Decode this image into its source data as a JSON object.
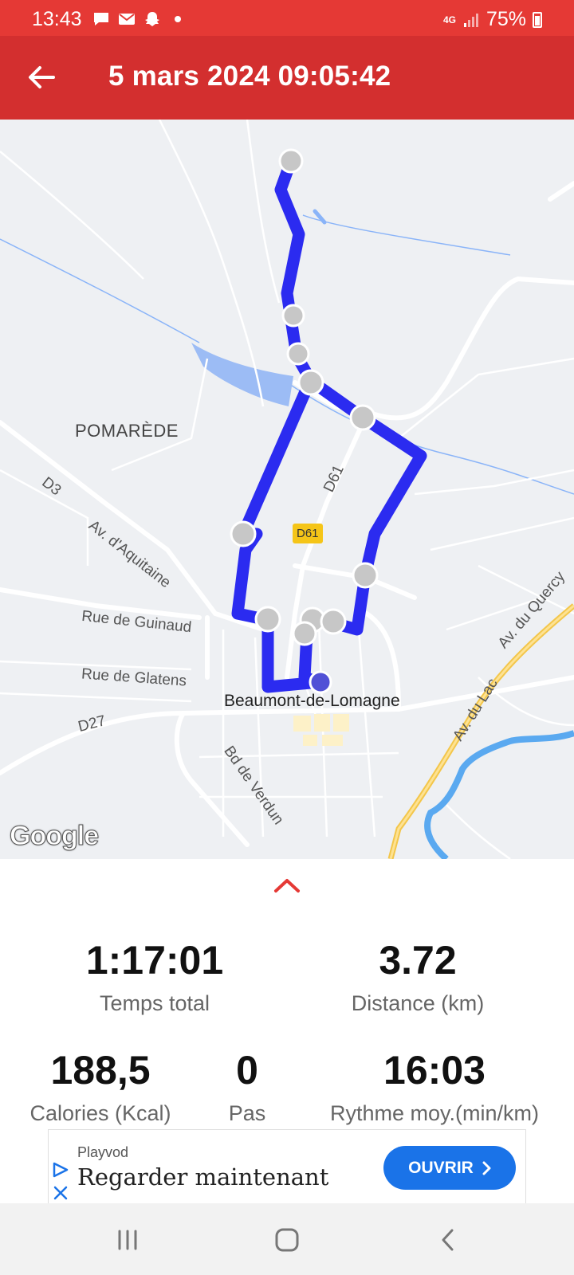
{
  "status_bar": {
    "time": "13:43",
    "network": "4G",
    "battery": "75%"
  },
  "app_bar": {
    "title": "5 mars 2024 09:05:42"
  },
  "map": {
    "labels": {
      "pomarede": "POMARÈDE",
      "d3": "D3",
      "av_aquitaine": "Av. d'Aquitaine",
      "rue_guinaud": "Rue de Guinaud",
      "rue_glatens": "Rue de Glatens",
      "d27": "D27",
      "bd_verdun": "Bd de Verdun",
      "d61": "D61",
      "d61_badge": "D61",
      "av_quercy": "Av. du Quercy",
      "av_lac": "Av. du Lac",
      "town": "Beaumont-de-Lomagne"
    },
    "logo": "Google",
    "route_color": "#2b2bf0"
  },
  "stats": {
    "total_time": {
      "value": "1:17:01",
      "label": "Temps total"
    },
    "distance": {
      "value": "3.72",
      "label": "Distance (km)"
    },
    "calories": {
      "value": "188,5",
      "label": "Calories (Kcal)"
    },
    "steps": {
      "value": "0",
      "label": "Pas"
    },
    "pace": {
      "value": "16:03",
      "label": "Rythme moy.(min/km)"
    }
  },
  "ad": {
    "brand": "Playvod",
    "title": "Regarder maintenant",
    "button": "OUVRIR"
  },
  "colors": {
    "status_bar": "#e53935",
    "app_bar": "#d32f2f",
    "ad_button": "#1a73e8"
  }
}
